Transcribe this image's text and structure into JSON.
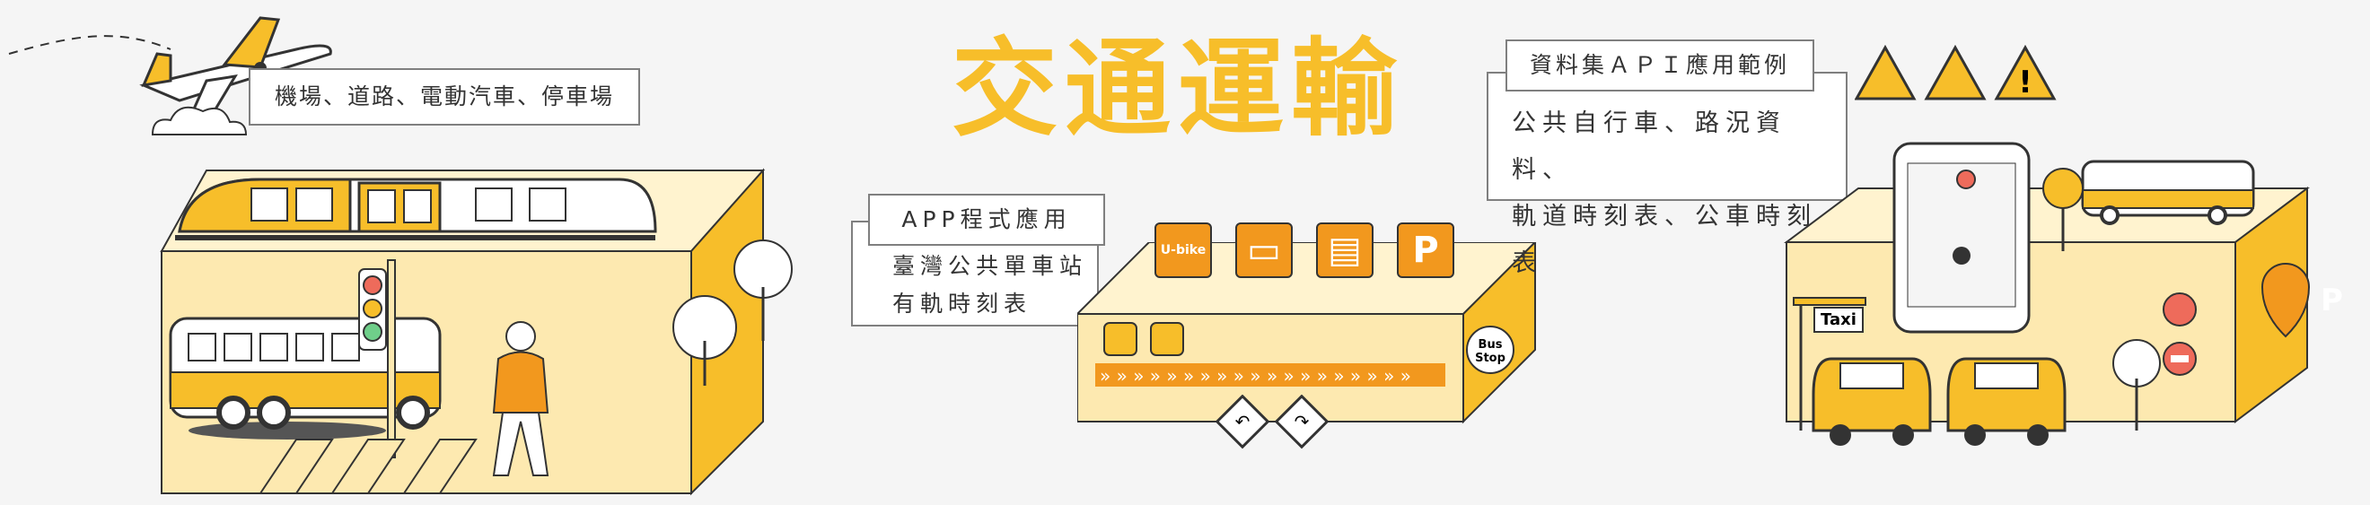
{
  "title": "交通運輸",
  "left_label": "機場、道路、電動汽車、停車場",
  "center": {
    "header": "APP程式應用",
    "lines": [
      "臺灣公共單車站",
      "有軌時刻表"
    ],
    "app_icon_text": "U-bike",
    "parking_letter": "P"
  },
  "right": {
    "header": "資料集ＡＰＩ應用範例",
    "lines": [
      "公共自行車、路況資料、",
      "軌道時刻表、公車時刻表"
    ],
    "taxi_sign": "Taxi",
    "taxi_roof": "Taxi",
    "bus_stop": "Bus\nStop",
    "parking_letter": "P"
  },
  "bus_stop_label": "Bus Stop",
  "colors": {
    "accent": "#f7be2a",
    "orange": "#f2981e",
    "cream": "#fde9b0",
    "outline": "#333333",
    "red": "#ee6b5b"
  }
}
